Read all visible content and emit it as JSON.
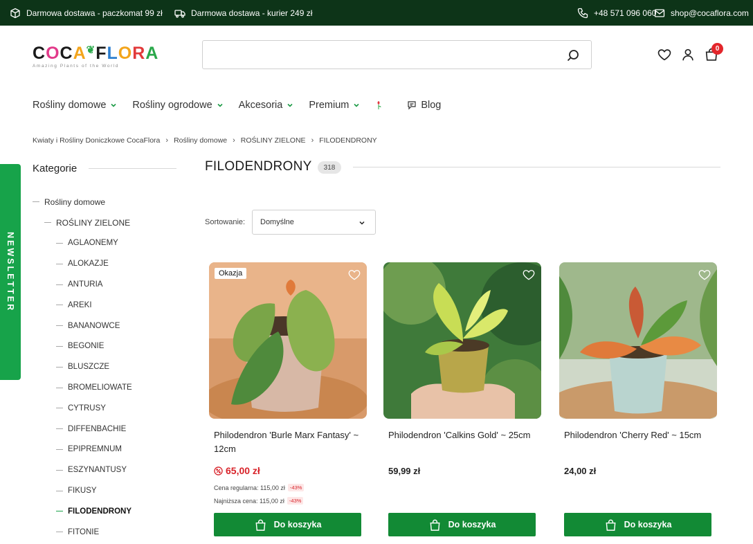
{
  "topbar": {
    "shipping_parcel": "Darmowa dostawa - paczkomat 99 zł",
    "shipping_courier": "Darmowa dostawa - kurier 249 zł",
    "phone": "+48 571 096 060",
    "email": "shop@cocaflora.com"
  },
  "logo": {
    "tagline": "Amazing Plants of the World"
  },
  "search": {
    "placeholder": ""
  },
  "cart": {
    "count": "0"
  },
  "nav": {
    "items": [
      {
        "label": "Rośliny domowe"
      },
      {
        "label": "Rośliny ogrodowe"
      },
      {
        "label": "Akcesoria"
      },
      {
        "label": "Premium"
      }
    ],
    "blog": "Blog"
  },
  "breadcrumb": [
    "Kwiaty i Rośliny Doniczkowe CocaFlora",
    "Rośliny domowe",
    "ROŚLINY ZIELONE",
    "FILODENDRONY"
  ],
  "sidebar": {
    "title": "Kategorie",
    "newsletter": "NEWSLETTER",
    "items": [
      {
        "label": "Rośliny domowe"
      },
      {
        "label": "ROŚLINY ZIELONE"
      },
      {
        "label": "AGLAONEMY"
      },
      {
        "label": "ALOKAZJE"
      },
      {
        "label": "ANTURIA"
      },
      {
        "label": "AREKI"
      },
      {
        "label": "BANANOWCE"
      },
      {
        "label": "BEGONIE"
      },
      {
        "label": "BLUSZCZE"
      },
      {
        "label": "BROMELIOWATE"
      },
      {
        "label": "CYTRUSY"
      },
      {
        "label": "DIFFENBACHIE"
      },
      {
        "label": "EPIPREMNUM"
      },
      {
        "label": "ESZYNANTUSY"
      },
      {
        "label": "FIKUSY"
      },
      {
        "label": "FILODENDRONY"
      },
      {
        "label": "FITONIE"
      }
    ]
  },
  "main": {
    "title": "FILODENDRONY",
    "count": "318",
    "sort_label": "Sortowanie:",
    "sort_value": "Domyślne"
  },
  "products": [
    {
      "badge": "Okazja",
      "name": "Philodendron 'Burle Marx Fantasy' ~ 12cm",
      "price": "65,00 zł",
      "regular_label": "Cena regularna: 115,00 zł",
      "regular_pct": "-43%",
      "lowest_label": "Najniższa cena: 115,00 zł",
      "lowest_pct": "-43%",
      "button": "Do koszyka"
    },
    {
      "name": "Philodendron 'Calkins Gold' ~ 25cm",
      "price": "59,99 zł",
      "button": "Do koszyka"
    },
    {
      "name": "Philodendron 'Cherry Red' ~ 15cm",
      "price": "24,00 zł",
      "button": "Do koszyka"
    }
  ],
  "colors": {
    "topbar_bg": "#0d3418",
    "accent_green": "#128a35",
    "sale_red": "#d8232a"
  }
}
